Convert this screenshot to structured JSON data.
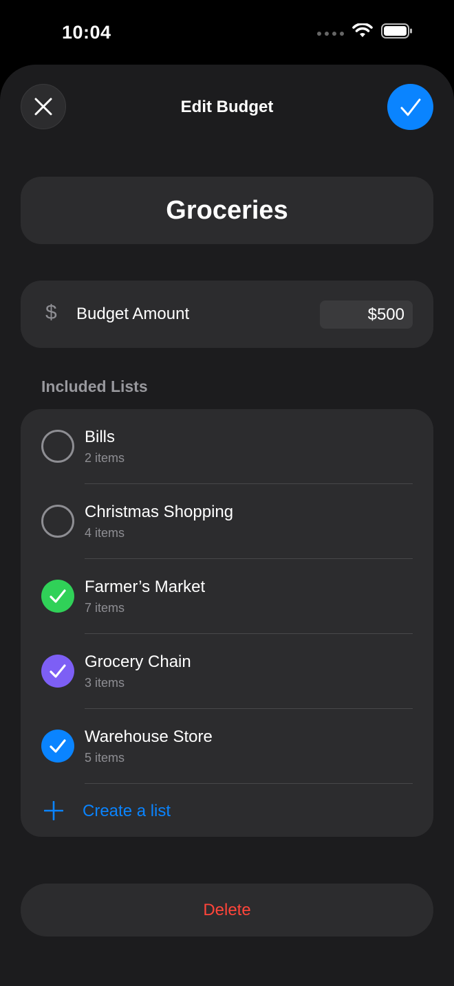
{
  "status_bar": {
    "time": "10:04"
  },
  "header": {
    "title": "Edit Budget"
  },
  "budget": {
    "name": "Groceries",
    "amount_label": "Budget Amount",
    "currency_symbol": "$",
    "amount_value": "$500"
  },
  "lists_section": {
    "header": "Included Lists",
    "items": [
      {
        "name": "Bills",
        "count": "2 items",
        "checked": false,
        "color": ""
      },
      {
        "name": "Christmas Shopping",
        "count": "4 items",
        "checked": false,
        "color": ""
      },
      {
        "name": "Farmer’s Market",
        "count": "7 items",
        "checked": true,
        "color": "#30d158"
      },
      {
        "name": "Grocery Chain",
        "count": "3 items",
        "checked": true,
        "color": "#7d5ff5"
      },
      {
        "name": "Warehouse Store",
        "count": "5 items",
        "checked": true,
        "color": "#0a84ff"
      }
    ],
    "create_label": "Create a list"
  },
  "delete_label": "Delete",
  "colors": {
    "accent": "#0a84ff",
    "destructive": "#ff453a"
  }
}
